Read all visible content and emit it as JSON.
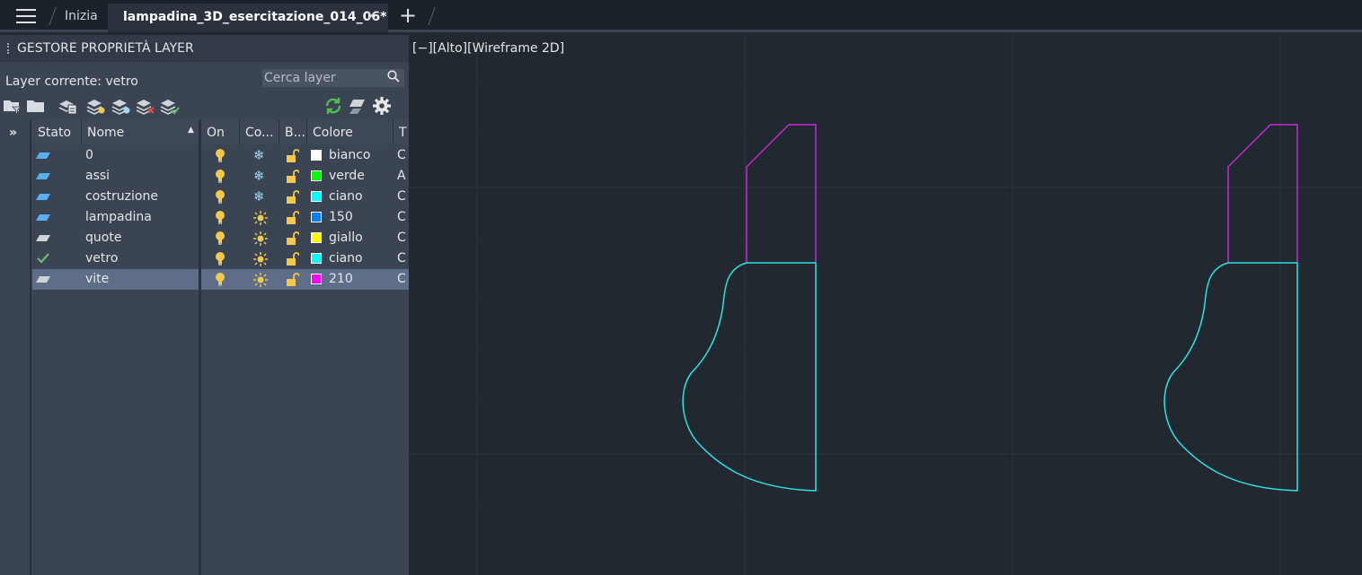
{
  "tabs": {
    "home": "Inizia",
    "active": "lampadina_3D_esercitazione_014_06*",
    "close_glyph": "✕",
    "add_glyph": "+"
  },
  "panel": {
    "title": "GESTORE PROPRIETÀ LAYER",
    "current_layer": "Layer corrente: vetro",
    "search_placeholder": "Cerca layer"
  },
  "columns": {
    "stato": "Stato",
    "nome": "Nome",
    "on": "On",
    "congela": "Co...",
    "blocca": "B...",
    "colore": "Colore",
    "tipolinea": "T"
  },
  "layers": [
    {
      "name": "0",
      "color_name": "bianco",
      "color": "#ffffff",
      "frozen": true,
      "current": false,
      "linetype": "C"
    },
    {
      "name": "assi",
      "color_name": "verde",
      "color": "#00ff00",
      "frozen": true,
      "current": false,
      "linetype": "A"
    },
    {
      "name": "costruzione",
      "color_name": "ciano",
      "color": "#00ffff",
      "frozen": true,
      "current": false,
      "linetype": "C"
    },
    {
      "name": "lampadina",
      "color_name": "150",
      "color": "#007fff",
      "frozen": false,
      "current": false,
      "linetype": "C"
    },
    {
      "name": "quote",
      "color_name": "giallo",
      "color": "#ffff00",
      "frozen": false,
      "current": false,
      "linetype": "C"
    },
    {
      "name": "vetro",
      "color_name": "ciano",
      "color": "#00ffff",
      "frozen": false,
      "current": true,
      "linetype": "C"
    },
    {
      "name": "vite",
      "color_name": "210",
      "color": "#ff00ff",
      "frozen": false,
      "current": false,
      "linetype": "C"
    }
  ],
  "selected_layer": "vite",
  "viewport": {
    "minus": "[−]",
    "view": "[Alto]",
    "style": "[Wireframe 2D]"
  },
  "colors": {
    "accent_cyan": "#2de2e6",
    "accent_magenta": "#c42bd6",
    "current_check": "#5fc26b",
    "refresh": "#4fbf4f"
  }
}
